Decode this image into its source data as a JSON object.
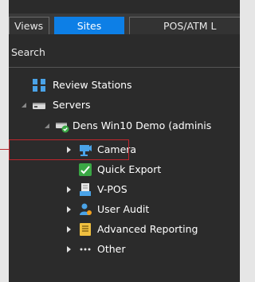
{
  "tabs": {
    "views": "Views",
    "sites": "Sites",
    "pos": "POS/ATM L"
  },
  "search": {
    "label": "Search"
  },
  "tree": {
    "review_stations": "Review Stations",
    "servers": "Servers",
    "server_node": "Dens Win10 Demo (adminis",
    "camera": "Camera",
    "quick_export": "Quick Export",
    "vpos": "V-POS",
    "user_audit": "User Audit",
    "advanced_reporting": "Advanced Reporting",
    "other": "Other"
  },
  "colors": {
    "accent": "#0d7fe6",
    "highlight": "#c0262c",
    "panel": "#2b2b2b"
  },
  "icons": [
    "review-stations-icon",
    "server-icon",
    "server-online-icon",
    "camera-icon",
    "quick-export-icon",
    "vpos-icon",
    "user-audit-icon",
    "advanced-reporting-icon",
    "other-icon"
  ]
}
